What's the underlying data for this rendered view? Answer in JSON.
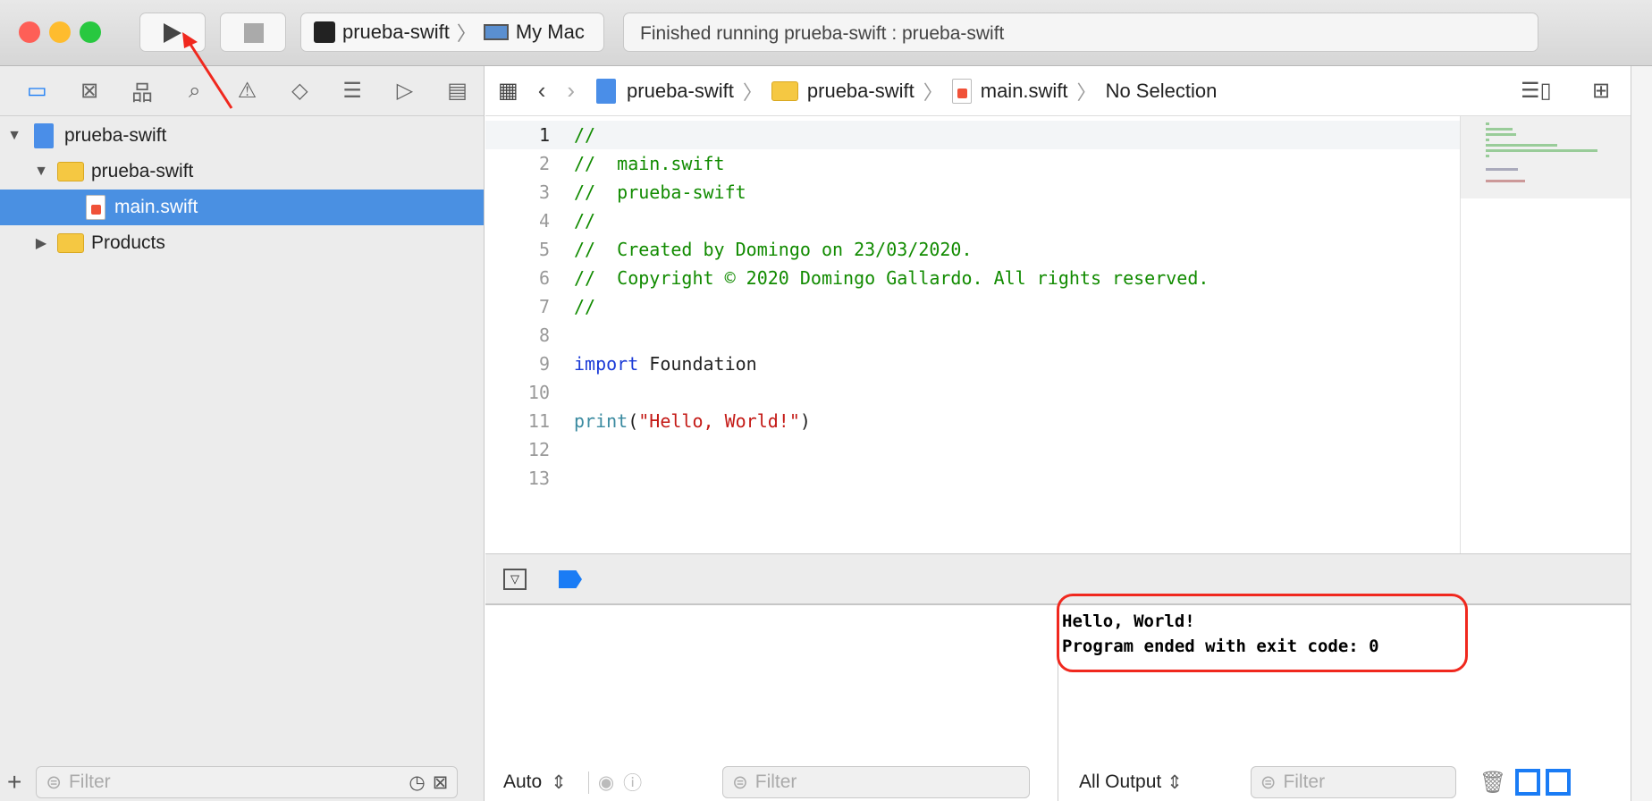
{
  "toolbar": {
    "scheme": "prueba-swift",
    "destination": "My Mac",
    "status": "Finished running prueba-swift : prueba-swift"
  },
  "navigator": {
    "tree": [
      {
        "label": "prueba-swift"
      },
      {
        "label": "prueba-swift"
      },
      {
        "label": "main.swift"
      },
      {
        "label": "Products"
      }
    ],
    "filter_placeholder": "Filter"
  },
  "jumpbar": {
    "items": [
      "prueba-swift",
      "prueba-swift",
      "main.swift",
      "No Selection"
    ]
  },
  "editor": {
    "lines": [
      {
        "n": "1",
        "t": "//",
        "c": "cm"
      },
      {
        "n": "2",
        "t": "//  main.swift",
        "c": "cm"
      },
      {
        "n": "3",
        "t": "//  prueba-swift",
        "c": "cm"
      },
      {
        "n": "4",
        "t": "//",
        "c": "cm"
      },
      {
        "n": "5",
        "t": "//  Created by Domingo on 23/03/2020.",
        "c": "cm"
      },
      {
        "n": "6",
        "t": "//  Copyright © 2020 Domingo Gallardo. All rights reserved.",
        "c": "cm"
      },
      {
        "n": "7",
        "t": "//",
        "c": "cm"
      },
      {
        "n": "8",
        "t": "",
        "c": ""
      },
      {
        "n": "9",
        "kw": "import",
        "rest": " Foundation"
      },
      {
        "n": "10",
        "t": "",
        "c": ""
      },
      {
        "n": "11",
        "fn": "print",
        "p1": "(",
        "str": "\"Hello, World!\"",
        "p2": ")"
      },
      {
        "n": "12",
        "t": "",
        "c": ""
      },
      {
        "n": "13",
        "t": "",
        "c": ""
      }
    ]
  },
  "debug": {
    "variables_mode": "Auto",
    "variables_filter": "Filter",
    "output_mode": "All Output",
    "output_filter": "Filter",
    "output": [
      "Hello, World!",
      "Program ended with exit code: 0"
    ]
  },
  "colors": {
    "accent": "#1a7cf5",
    "annotation": "#f0281e"
  }
}
